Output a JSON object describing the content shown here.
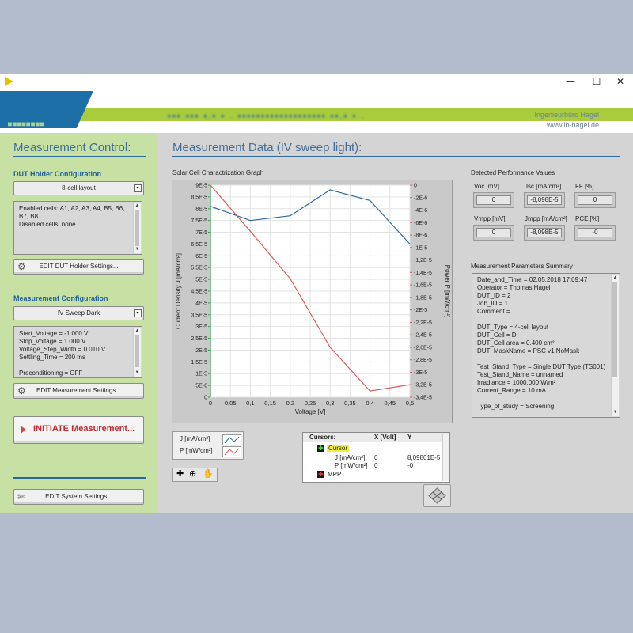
{
  "window": {
    "minimize": "—",
    "maximize": "☐",
    "close": "✕"
  },
  "header": {
    "logo": "■■■■■■■■",
    "title_blurred": "▪▪▪ ▪▪▪ ▪.▪ ▪ . ▪▪▪▪▪▪▪▪▪▪▪▪▪▪▪▪▪▪▪ ▪▪.▪ ▪ .",
    "company_name": "Ingenieurbüro Hagel",
    "company_url": "www.ib-hagel.de"
  },
  "left": {
    "title": "Measurement Control:",
    "dut_holder": {
      "title": "DUT Holder Configuration",
      "dropdown": "8-cell layout",
      "lines": [
        "Enabled cells: A1, A2, A3, A4, B5, B6,",
        "B7, B8",
        "Disabled cells: none"
      ],
      "edit_button": "EDIT DUT Holder Settings..."
    },
    "measurement": {
      "title": "Measurement Configuration",
      "dropdown": "IV Sweep Dark",
      "lines": [
        "Start_Voltage = -1.000 V",
        "Stop_Voltage = 1.000 V",
        "Voltage_Step_Width = 0.010 V",
        "Settling_Time = 200 ms",
        "",
        "Preconditioning = OFF"
      ],
      "edit_button": "EDIT Measurement Settings..."
    },
    "initiate_button": "INITIATE Measurement...",
    "system_button": "EDIT System Settings..."
  },
  "right": {
    "title": "Measurement Data (IV sweep light):",
    "graph_title": "Solar Cell Charactrization Graph",
    "perf": {
      "title": "Detected Performance Values",
      "items": [
        {
          "label": "Voc [mV]",
          "value": "0"
        },
        {
          "label": "Jsc [mA/cm²]",
          "value": "-8,098E-5"
        },
        {
          "label": "FF [%]",
          "value": "0"
        },
        {
          "label": "Vmpp [mV]",
          "value": "0"
        },
        {
          "label": "Jmpp [mA/cm²]",
          "value": "-8,098E-5"
        },
        {
          "label": "PCE [%]",
          "value": "-0"
        }
      ]
    },
    "summary": {
      "title": "Measurement Parameters Summary",
      "lines": [
        "Date_and_Time = 02.05.2018 17:09:47",
        "Operator = Thomas Hagel",
        "DUT_ID = 2",
        "Job_ID = 1",
        "Comment =",
        "",
        "DUT_Type = 4-cell layout",
        "DUT_Cell = D",
        "DUT_Cell area = 0.400 cm²",
        "DUT_MaskName = PSC v1 NoMask",
        "",
        "Test_Stand_Type = Single DUT Type (TS001)",
        "Test_Stand_Name = unnamed",
        "Irradiance = 1000.000 W/m²",
        "Current_Range = 10 mA",
        "",
        "Type_of_study = Screening"
      ]
    },
    "legend": {
      "items": [
        {
          "label": "J [mA/cm²]",
          "color": "#2d6a9a"
        },
        {
          "label": "P [mW/cm²]",
          "color": "#e05a5a"
        }
      ]
    },
    "cursors": {
      "header": [
        "Cursors:",
        "X [Volt]",
        "Y"
      ],
      "cursor_name": "Cursor",
      "rows": [
        {
          "label": "J [mA/cm²]",
          "x": "0",
          "y": "8,09801E-5"
        },
        {
          "label": "P [mW/cm²]",
          "x": "0",
          "y": "-0"
        }
      ],
      "mpp": "MPP"
    }
  },
  "chart_data": {
    "type": "line",
    "xlabel": "Voltage [V]",
    "ylabel": "Current Density J [mA/cm²]",
    "y2label": "Power P [mW/cm²]",
    "xlim": [
      0,
      0.5
    ],
    "ylim": [
      0,
      9e-05
    ],
    "y2lim": [
      -3.4e-05,
      0
    ],
    "x_ticks": [
      "0",
      "0,05",
      "0,1",
      "0,15",
      "0,2",
      "0,25",
      "0,3",
      "0,35",
      "0,4",
      "0,45",
      "0,5"
    ],
    "y_ticks": [
      "0",
      "5E-6",
      "1E-5",
      "1,5E-5",
      "2E-5",
      "2,5E-5",
      "3E-5",
      "3,5E-5",
      "4E-5",
      "4,5E-5",
      "5E-5",
      "5,5E-5",
      "6E-5",
      "6,5E-5",
      "7E-5",
      "7,5E-5",
      "8E-5",
      "8,5E-5",
      "9E-5"
    ],
    "y2_ticks": [
      "0",
      "-2E-6",
      "-4E-6",
      "-6E-6",
      "-8E-6",
      "-1E-5",
      "-1,2E-5",
      "-1,4E-5",
      "-1,6E-5",
      "-1,8E-5",
      "-2E-5",
      "-2,2E-5",
      "-2,4E-5",
      "-2,6E-5",
      "-2,8E-5",
      "-3E-5",
      "-3,2E-5",
      "-3,4E-5"
    ],
    "series": [
      {
        "name": "J [mA/cm²]",
        "axis": "left",
        "color": "#2d6a9a",
        "x": [
          0,
          0.1,
          0.2,
          0.3,
          0.4,
          0.5
        ],
        "values": [
          8.1e-05,
          7.5e-05,
          7.7e-05,
          8.8e-05,
          8.35e-05,
          6.5e-05
        ]
      },
      {
        "name": "P [mW/cm²]",
        "axis": "right",
        "color": "#e05a5a",
        "x": [
          0,
          0.1,
          0.2,
          0.3,
          0.4,
          0.5
        ],
        "values": [
          0,
          -7.4e-06,
          -1.5e-05,
          -2.6e-05,
          -3.3e-05,
          -3.2e-05
        ]
      }
    ],
    "grid": true
  }
}
